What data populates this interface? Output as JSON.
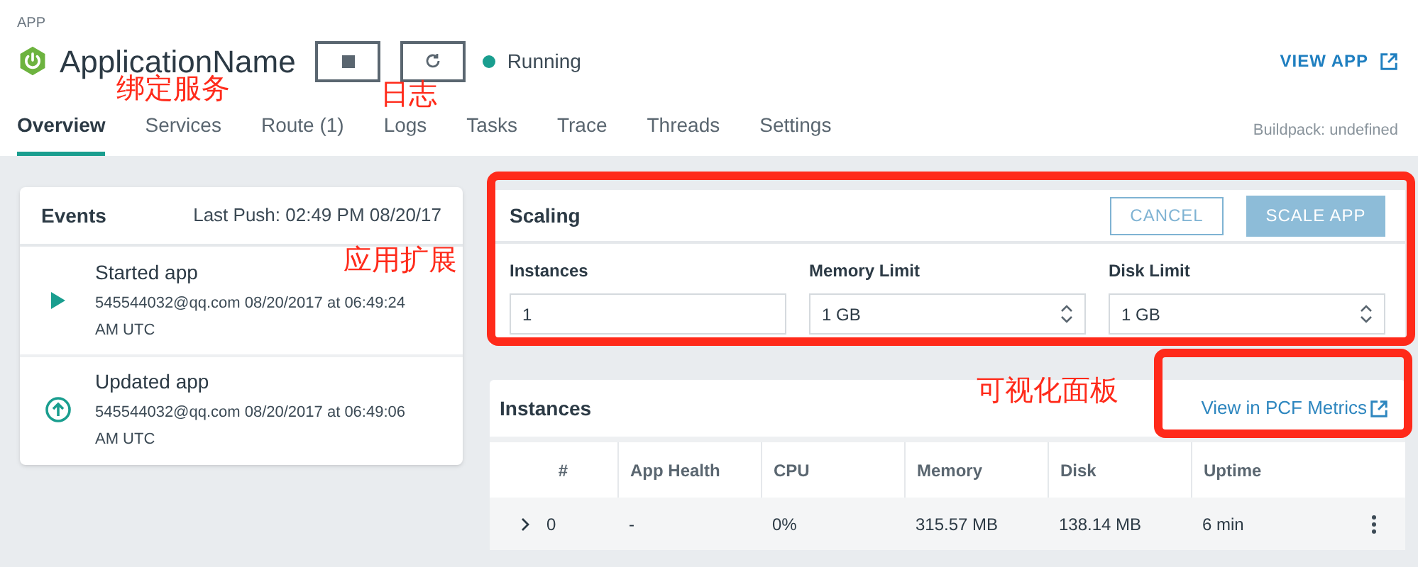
{
  "header": {
    "label": "APP",
    "name": "ApplicationName",
    "status": {
      "text": "Running",
      "running": true
    },
    "view_app": "VIEW APP",
    "buildpack": "Buildpack: undefined"
  },
  "tabs": [
    {
      "label": "Overview",
      "selected": true
    },
    {
      "label": "Services",
      "selected": false
    },
    {
      "label": "Route (1)",
      "selected": false
    },
    {
      "label": "Logs",
      "selected": false
    },
    {
      "label": "Tasks",
      "selected": false
    },
    {
      "label": "Trace",
      "selected": false
    },
    {
      "label": "Threads",
      "selected": false
    },
    {
      "label": "Settings",
      "selected": false
    }
  ],
  "events": {
    "title": "Events",
    "last_push": "Last Push: 02:49 PM 08/20/17",
    "items": [
      {
        "kind": "started",
        "title": "Started app",
        "detail": "545544032@qq.com 08/20/2017 at 06:49:24 AM UTC"
      },
      {
        "kind": "updated",
        "title": "Updated app",
        "detail": "545544032@qq.com 08/20/2017 at 06:49:06 AM UTC"
      }
    ]
  },
  "scaling": {
    "title": "Scaling",
    "cancel": "CANCEL",
    "scale": {
      "label": "SCALE APP",
      "disabled": true
    },
    "fields": [
      {
        "kind": "input",
        "label": "Instances",
        "value": "1"
      },
      {
        "kind": "select",
        "label": "Memory Limit",
        "value": "1 GB"
      },
      {
        "kind": "select",
        "label": "Disk Limit",
        "value": "1 GB"
      }
    ]
  },
  "instances": {
    "title": "Instances",
    "metrics_link": "View in PCF Metrics",
    "columns": [
      "#",
      "App Health",
      "CPU",
      "Memory",
      "Disk",
      "Uptime"
    ],
    "rows": [
      {
        "expanded": false,
        "cells": [
          "0",
          "-",
          "0%",
          "315.57 MB",
          "138.14 MB",
          "6 min"
        ]
      }
    ]
  },
  "annotations": [
    {
      "text": "绑定服务"
    },
    {
      "text": "日志"
    },
    {
      "text": "应用扩展"
    },
    {
      "text": "可视化面板"
    }
  ]
}
